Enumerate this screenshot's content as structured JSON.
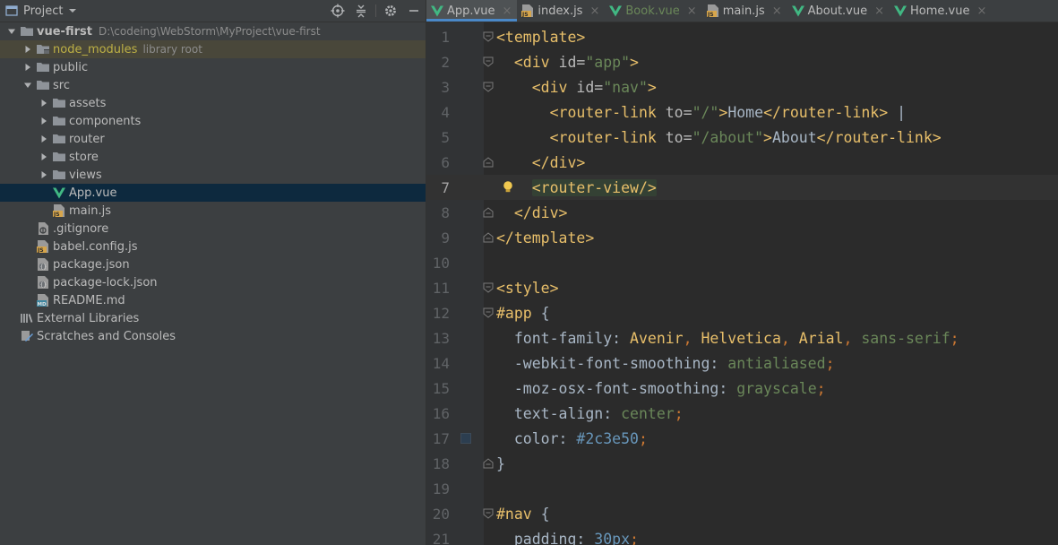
{
  "project": {
    "title": "Project",
    "tree": [
      {
        "name": "vue-first",
        "path": "D:\\codeing\\WebStorm\\MyProject\\vue-first",
        "depth": 0,
        "arrow": "open",
        "icon": "folder",
        "kind": "root"
      },
      {
        "name": "node_modules",
        "hint": "library root",
        "depth": 1,
        "arrow": "closed",
        "icon": "folder-lib",
        "kind": "nm"
      },
      {
        "name": "public",
        "depth": 1,
        "arrow": "closed",
        "icon": "folder"
      },
      {
        "name": "src",
        "depth": 1,
        "arrow": "open",
        "icon": "folder"
      },
      {
        "name": "assets",
        "depth": 2,
        "arrow": "closed",
        "icon": "folder"
      },
      {
        "name": "components",
        "depth": 2,
        "arrow": "closed",
        "icon": "folder"
      },
      {
        "name": "router",
        "depth": 2,
        "arrow": "closed",
        "icon": "folder"
      },
      {
        "name": "store",
        "depth": 2,
        "arrow": "closed",
        "icon": "folder"
      },
      {
        "name": "views",
        "depth": 2,
        "arrow": "closed",
        "icon": "folder"
      },
      {
        "name": "App.vue",
        "depth": 2,
        "arrow": "none",
        "icon": "vue",
        "kind": "selected"
      },
      {
        "name": "main.js",
        "depth": 2,
        "arrow": "none",
        "icon": "js"
      },
      {
        "name": ".gitignore",
        "depth": 1,
        "arrow": "none",
        "icon": "text"
      },
      {
        "name": "babel.config.js",
        "depth": 1,
        "arrow": "none",
        "icon": "js"
      },
      {
        "name": "package.json",
        "depth": 1,
        "arrow": "none",
        "icon": "json"
      },
      {
        "name": "package-lock.json",
        "depth": 1,
        "arrow": "none",
        "icon": "json"
      },
      {
        "name": "README.md",
        "depth": 1,
        "arrow": "none",
        "icon": "md"
      },
      {
        "name": "External Libraries",
        "depth": 0,
        "arrow": "none",
        "icon": "libs"
      },
      {
        "name": "Scratches and Consoles",
        "depth": 0,
        "arrow": "none",
        "icon": "scratch"
      }
    ]
  },
  "tabs": [
    {
      "label": "App.vue",
      "icon": "vue",
      "active": true,
      "modified": false
    },
    {
      "label": "index.js",
      "icon": "js",
      "active": false,
      "modified": false
    },
    {
      "label": "Book.vue",
      "icon": "vue",
      "active": false,
      "modified": true
    },
    {
      "label": "main.js",
      "icon": "js",
      "active": false,
      "modified": false
    },
    {
      "label": "About.vue",
      "icon": "vue",
      "active": false,
      "modified": false
    },
    {
      "label": "Home.vue",
      "icon": "vue",
      "active": false,
      "modified": false
    }
  ],
  "tab_close_glyph": "×",
  "editor": {
    "current_line": 7,
    "lines": [
      {
        "n": "1",
        "fold": "open",
        "t": [
          [
            "tag",
            "<template>"
          ]
        ]
      },
      {
        "n": "2",
        "fold": "open",
        "t": [
          [
            "txt",
            "  "
          ],
          [
            "tag",
            "<div "
          ],
          [
            "attr",
            "id="
          ],
          [
            "str",
            "\"app\""
          ],
          [
            "tag",
            ">"
          ]
        ]
      },
      {
        "n": "3",
        "fold": "open",
        "t": [
          [
            "txt",
            "    "
          ],
          [
            "tag",
            "<div "
          ],
          [
            "attr",
            "id="
          ],
          [
            "str",
            "\"nav\""
          ],
          [
            "tag",
            ">"
          ]
        ]
      },
      {
        "n": "4",
        "fold": "",
        "t": [
          [
            "txt",
            "      "
          ],
          [
            "tag",
            "<router-link "
          ],
          [
            "attr",
            "to="
          ],
          [
            "str",
            "\"/\""
          ],
          [
            "tag",
            ">"
          ],
          [
            "txt",
            "Home"
          ],
          [
            "tag",
            "</router-link>"
          ],
          [
            "txt",
            " |"
          ]
        ]
      },
      {
        "n": "5",
        "fold": "",
        "t": [
          [
            "txt",
            "      "
          ],
          [
            "tag",
            "<router-link "
          ],
          [
            "attr",
            "to="
          ],
          [
            "str",
            "\"/about\""
          ],
          [
            "tag",
            ">"
          ],
          [
            "txt",
            "About"
          ],
          [
            "tag",
            "</router-link>"
          ]
        ]
      },
      {
        "n": "6",
        "fold": "close",
        "t": [
          [
            "txt",
            "    "
          ],
          [
            "tag",
            "</div>"
          ]
        ]
      },
      {
        "n": "7",
        "fold": "",
        "bulb": true,
        "t": [
          [
            "txt",
            "    "
          ],
          [
            "tag hl",
            "<router-view/>"
          ]
        ]
      },
      {
        "n": "8",
        "fold": "close",
        "t": [
          [
            "txt",
            "  "
          ],
          [
            "tag",
            "</div>"
          ]
        ]
      },
      {
        "n": "9",
        "fold": "close",
        "t": [
          [
            "tag",
            "</template>"
          ]
        ]
      },
      {
        "n": "10",
        "fold": "",
        "t": []
      },
      {
        "n": "11",
        "fold": "open",
        "t": [
          [
            "tag",
            "<style>"
          ]
        ]
      },
      {
        "n": "12",
        "fold": "open",
        "t": [
          [
            "tag",
            "#app "
          ],
          [
            "txt",
            "{"
          ]
        ]
      },
      {
        "n": "13",
        "fold": "",
        "t": [
          [
            "txt",
            "  font-family: "
          ],
          [
            "val",
            "Avenir"
          ],
          [
            "punc",
            ", "
          ],
          [
            "val",
            "Helvetica"
          ],
          [
            "punc",
            ", "
          ],
          [
            "val",
            "Arial"
          ],
          [
            "punc",
            ", "
          ],
          [
            "valg",
            "sans-serif"
          ],
          [
            "punc",
            ";"
          ]
        ]
      },
      {
        "n": "14",
        "fold": "",
        "t": [
          [
            "txt",
            "  -webkit-font-smoothing: "
          ],
          [
            "valg",
            "antialiased"
          ],
          [
            "punc",
            ";"
          ]
        ]
      },
      {
        "n": "15",
        "fold": "",
        "t": [
          [
            "txt",
            "  -moz-osx-font-smoothing: "
          ],
          [
            "valg",
            "grayscale"
          ],
          [
            "punc",
            ";"
          ]
        ]
      },
      {
        "n": "16",
        "fold": "",
        "t": [
          [
            "txt",
            "  text-align: "
          ],
          [
            "valg",
            "center"
          ],
          [
            "punc",
            ";"
          ]
        ]
      },
      {
        "n": "17",
        "fold": "",
        "swatch": "#2c3e50",
        "t": [
          [
            "txt",
            "  color: "
          ],
          [
            "num",
            "#2c3e50"
          ],
          [
            "punc",
            ";"
          ]
        ]
      },
      {
        "n": "18",
        "fold": "close",
        "t": [
          [
            "txt",
            "}"
          ]
        ]
      },
      {
        "n": "19",
        "fold": "",
        "t": []
      },
      {
        "n": "20",
        "fold": "open",
        "t": [
          [
            "tag",
            "#nav "
          ],
          [
            "txt",
            "{"
          ]
        ]
      },
      {
        "n": "21",
        "fold": "",
        "t": [
          [
            "txt",
            "  padding: "
          ],
          [
            "num",
            "30px"
          ],
          [
            "punc",
            ";"
          ]
        ]
      }
    ]
  },
  "colors": {
    "accent": "#4a88c7",
    "vue_green": "#41b883",
    "js_yellow": "#d6a54b"
  }
}
